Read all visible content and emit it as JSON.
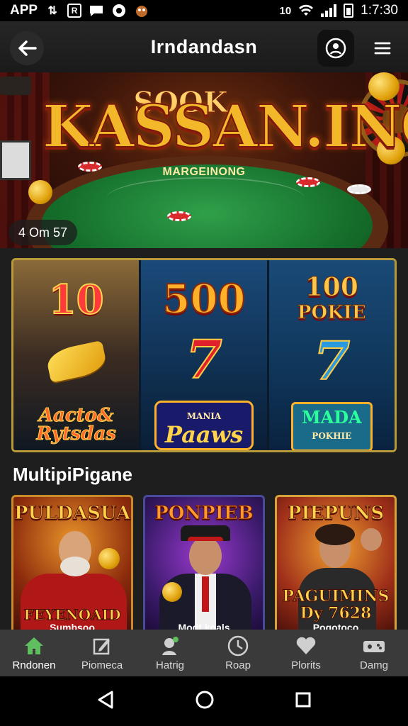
{
  "status_bar": {
    "left_text": "APP",
    "notif_letter": "R",
    "time": "1:7:30",
    "net_label": "10"
  },
  "app_bar": {
    "title": "Irndandasn"
  },
  "banner": {
    "logo_main": "KASSAN.INO",
    "logo_top": "SOOK",
    "subtitle": "MARGEINONG",
    "badge": "4 Om 57"
  },
  "promos": [
    {
      "amount": "10",
      "label": "Aacto& Rytsdas"
    },
    {
      "amount": "500",
      "label": "Paaws",
      "label_small": "MANIA"
    },
    {
      "amount": "100",
      "amount_sub": "POKIE",
      "label": "MADA",
      "label_small": "POKHIE"
    }
  ],
  "section_title": "MultipiPigane",
  "games": [
    {
      "title": "PULDASUA",
      "sub": "FEYENOAID",
      "caption": "Sumbsoo"
    },
    {
      "title": "PONPIEB",
      "caption": "Modt koals"
    },
    {
      "title": "PIEPUNS",
      "sub": "PAGUIMINS Dy 7628",
      "caption": "Pogotoco"
    }
  ],
  "bottom_nav": [
    {
      "label": "Rndonen",
      "icon": "home-icon",
      "active": true
    },
    {
      "label": "Piomeca",
      "icon": "edit-icon"
    },
    {
      "label": "Hatrig",
      "icon": "person-pin-icon"
    },
    {
      "label": "Roap",
      "icon": "clock-icon"
    },
    {
      "label": "Plorits",
      "icon": "heart-icon"
    },
    {
      "label": "Damg",
      "icon": "gamepad-icon"
    }
  ],
  "colors": {
    "accent_gold": "#ffd34a",
    "nav_active": "#5fbf5f"
  }
}
